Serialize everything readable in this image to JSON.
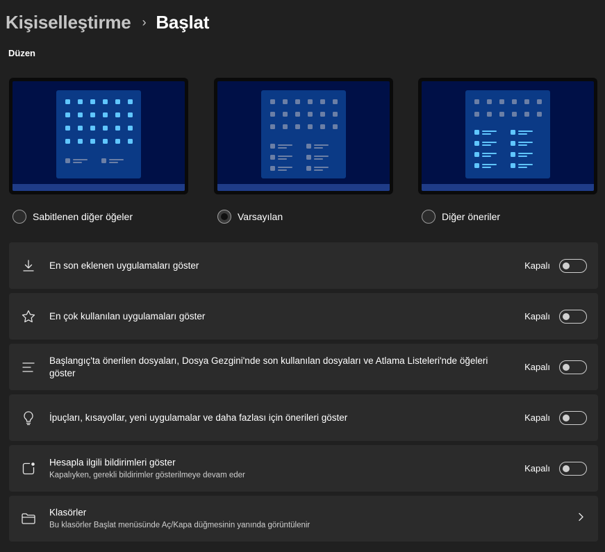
{
  "header": {
    "parent": "Kişiselleştirme",
    "separator": "›",
    "current": "Başlat"
  },
  "layout_section": {
    "title": "Düzen",
    "options": [
      {
        "label": "Sabitlenen diğer öğeler",
        "selected": false
      },
      {
        "label": "Varsayılan",
        "selected": true
      },
      {
        "label": "Diğer öneriler",
        "selected": false
      }
    ]
  },
  "settings": [
    {
      "icon": "download-icon",
      "title": "En son eklenen uygulamaları göster",
      "state": "Kapalı",
      "on": false
    },
    {
      "icon": "star-icon",
      "title": "En çok kullanılan uygulamaları göster",
      "state": "Kapalı",
      "on": false
    },
    {
      "icon": "list-lines-icon",
      "title": "Başlangıç'ta önerilen dosyaları, Dosya Gezgini'nde son kullanılan dosyaları ve Atlama Listeleri'nde öğeleri göster",
      "state": "Kapalı",
      "on": false
    },
    {
      "icon": "lightbulb-icon",
      "title": "İpuçları, kısayollar, yeni uygulamalar ve daha fazlası için önerileri göster",
      "state": "Kapalı",
      "on": false
    },
    {
      "icon": "notification-badge-icon",
      "title": "Hesapla ilgili bildirimleri göster",
      "subtitle": "Kapalıyken, gerekli bildirimler gösterilmeye devam eder",
      "state": "Kapalı",
      "on": false
    }
  ],
  "folders": {
    "icon": "folder-icon",
    "title": "Klasörler",
    "subtitle": "Bu klasörler Başlat menüsünde Aç/Kapa düğmesinin yanında görüntülenir"
  },
  "colors": {
    "background": "#202020",
    "card": "#2b2b2b",
    "accent_tile": "#60c6ff",
    "thumb_screen": "#001047",
    "thumb_menu": "#0b3a86"
  }
}
